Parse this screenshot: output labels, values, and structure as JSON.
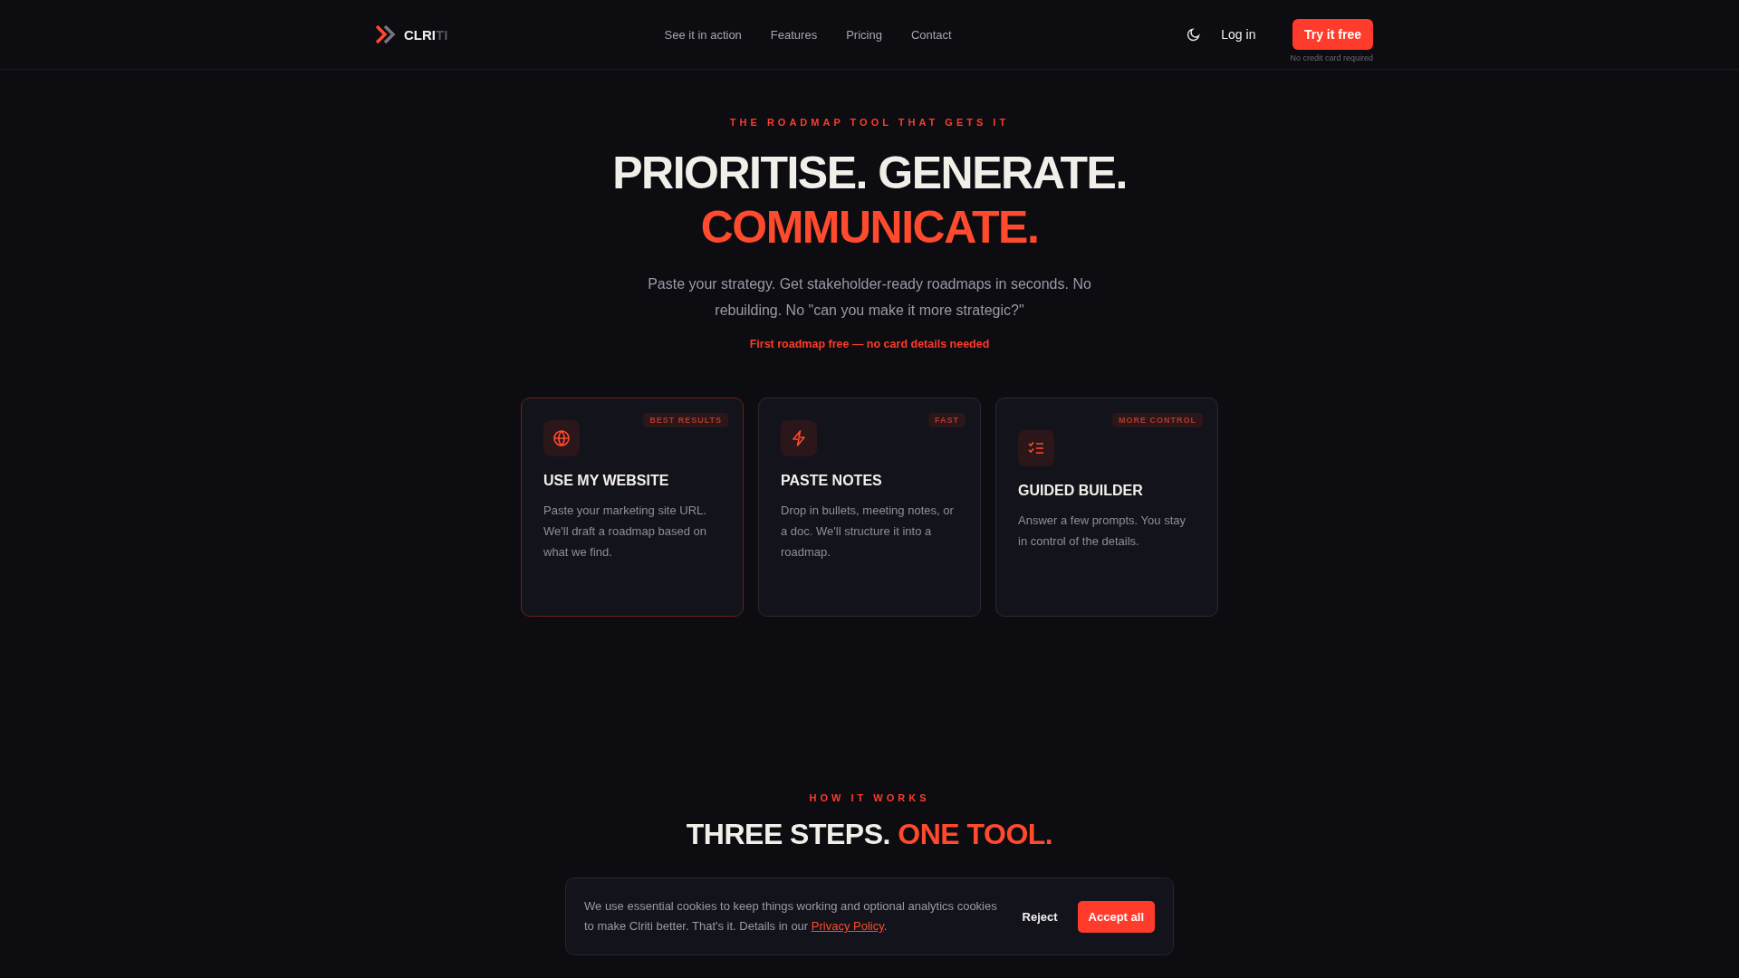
{
  "header": {
    "logo": {
      "strong": "CLRI",
      "dim": "TI"
    },
    "nav": [
      "See it in action",
      "Features",
      "Pricing",
      "Contact"
    ],
    "login": "Log in",
    "cta": "Try it free",
    "cta_note": "No credit card required"
  },
  "hero": {
    "eyebrow": "THE ROADMAP TOOL THAT GETS IT",
    "title_line1": "PRIORITISE. GENERATE.",
    "title_line2": "COMMUNICATE.",
    "subtitle": "Paste your strategy. Get stakeholder-ready roadmaps in seconds. No rebuilding. No \"can you make it more strategic?\"",
    "note": "First roadmap free — no card details needed"
  },
  "options": [
    {
      "kind": "website",
      "badge": "BEST RESULTS",
      "title": "USE MY WEBSITE",
      "text": "Paste your marketing site URL. We'll draft a roadmap based on what we find.",
      "selected": true
    },
    {
      "kind": "notes",
      "badge": "FAST",
      "title": "PASTE NOTES",
      "text": "Drop in bullets, meeting notes, or a doc. We'll structure it into a roadmap.",
      "selected": false
    },
    {
      "kind": "guided",
      "badge": "MORE CONTROL",
      "title": "GUIDED BUILDER",
      "text": "Answer a few prompts. You stay in control of the details.",
      "selected": false
    }
  ],
  "how": {
    "eyebrow": "HOW IT WORKS",
    "title": "THREE STEPS.",
    "title_accent": "ONE TOOL."
  },
  "cookie_banner": {
    "text": "We use essential cookies to keep things working and optional analytics cookies to make Clriti better. That's it. Details in our",
    "link": "Privacy Policy",
    "after": ".",
    "reject": "Reject",
    "accept": "Accept all"
  }
}
